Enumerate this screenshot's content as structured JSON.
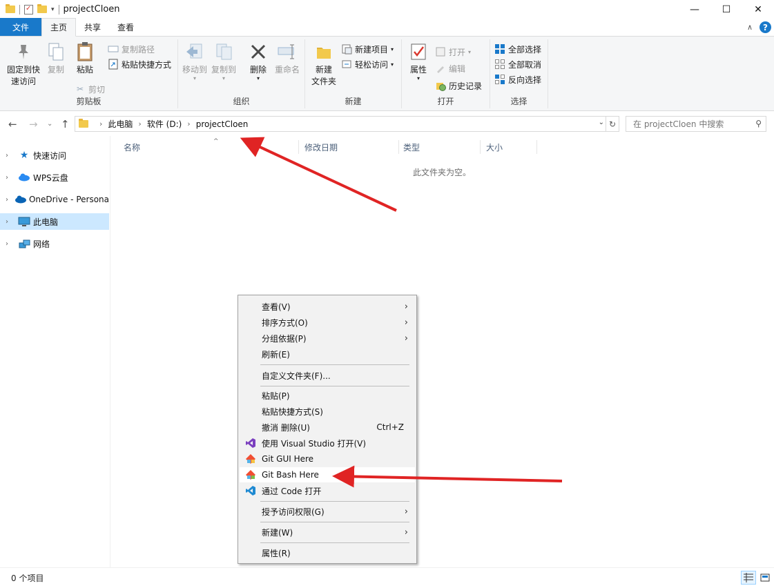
{
  "window": {
    "title": "projectCloen",
    "minimize": "—",
    "maximize": "☐",
    "close": "✕"
  },
  "ribbon_tabs": [
    {
      "label": "文件"
    },
    {
      "label": "主页"
    },
    {
      "label": "共享"
    },
    {
      "label": "查看"
    }
  ],
  "ribbon": {
    "clipboard": {
      "group_label": "剪贴板",
      "pin_label_1": "固定到快",
      "pin_label_2": "速访问",
      "copy_label": "复制",
      "paste_label": "粘贴",
      "copy_path_label": "复制路径",
      "paste_shortcut_label": "粘贴快捷方式",
      "cut_label": "剪切"
    },
    "organize": {
      "group_label": "组织",
      "move_to_label": "移动到",
      "copy_to_label": "复制到",
      "delete_label": "删除",
      "rename_label": "重命名"
    },
    "new": {
      "group_label": "新建",
      "new_folder_label_1": "新建",
      "new_folder_label_2": "文件夹",
      "new_item_label": "新建项目",
      "easy_access_label": "轻松访问"
    },
    "open": {
      "group_label": "打开",
      "properties_label": "属性",
      "open_label": "打开",
      "edit_label": "编辑",
      "history_label": "历史记录"
    },
    "select": {
      "group_label": "选择",
      "select_all_label": "全部选择",
      "select_none_label": "全部取消",
      "invert_label": "反向选择"
    }
  },
  "address": {
    "crumbs": [
      "此电脑",
      "软件 (D:)",
      "projectCloen"
    ],
    "search_placeholder": "在 projectCloen 中搜索"
  },
  "nav_pane": {
    "items": [
      {
        "label": "快速访问",
        "icon": "star-icon"
      },
      {
        "label": "WPS云盘",
        "icon": "cloud-icon"
      },
      {
        "label": "OneDrive - Persona",
        "icon": "onedrive-icon"
      },
      {
        "label": "此电脑",
        "icon": "computer-icon",
        "selected": true
      },
      {
        "label": "网络",
        "icon": "network-icon"
      }
    ]
  },
  "columns": {
    "name": "名称",
    "modified": "修改日期",
    "type": "类型",
    "size": "大小"
  },
  "empty_message": "此文件夹为空。",
  "status": {
    "item_count": "0 个项目"
  },
  "context_menu": {
    "view": "查看(V)",
    "sort_by": "排序方式(O)",
    "group_by": "分组依据(P)",
    "refresh": "刷新(E)",
    "customize": "自定义文件夹(F)...",
    "paste": "粘贴(P)",
    "paste_shortcut": "粘贴快捷方式(S)",
    "undo_delete": "撤消 删除(U)",
    "undo_shortcut": "Ctrl+Z",
    "open_visual_studio": "使用 Visual Studio 打开(V)",
    "git_gui": "Git GUI Here",
    "git_bash": "Git Bash Here",
    "open_with_code": "通过 Code 打开",
    "give_access": "授予访问权限(G)",
    "new": "新建(W)",
    "properties": "属性(R)"
  },
  "colors": {
    "accent": "#1979ca",
    "selection": "#cce8ff",
    "annotation_arrow": "#e02424"
  }
}
